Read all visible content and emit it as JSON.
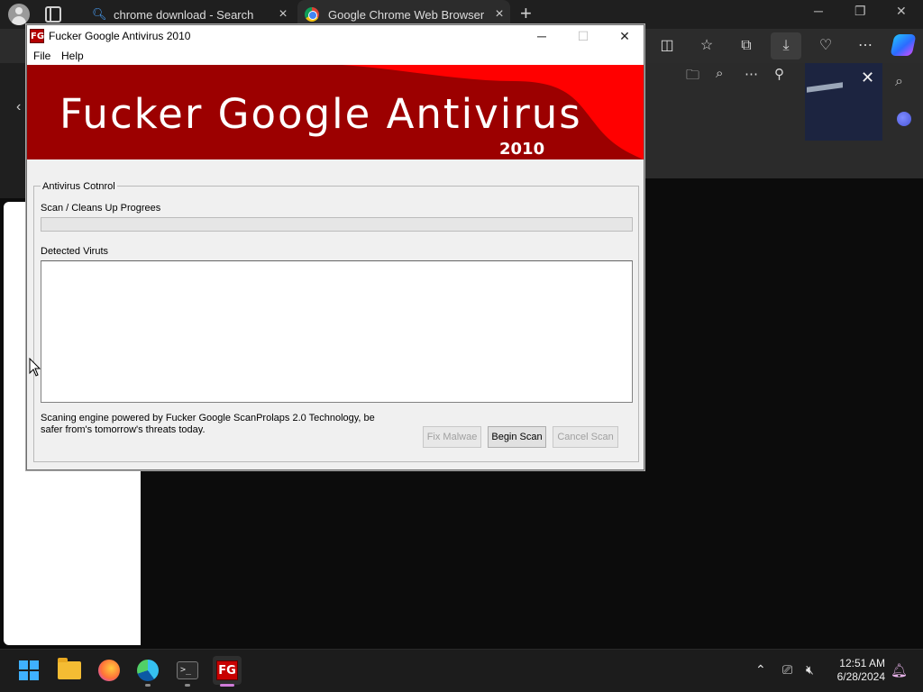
{
  "browser": {
    "tabs": [
      {
        "title": "chrome download - Search",
        "icon": "search-icon"
      },
      {
        "title": "Google Chrome Web Browser",
        "icon": "chrome-icon",
        "active": true
      }
    ],
    "new_tab_label": "+",
    "window_controls": {
      "minimize": "─",
      "restore": "❐",
      "close": "✕"
    },
    "toolbar_icons": [
      "split-screen-icon",
      "favorites-icon",
      "collections-icon",
      "downloads-icon",
      "browser-essentials-icon",
      "more-icon",
      "copilot-icon"
    ],
    "downloads_panel_icons": [
      "open-folder-icon",
      "search-icon",
      "more-icon",
      "pin-icon",
      "close-icon"
    ]
  },
  "app": {
    "title": "Fucker Google Antivirus 2010",
    "icon_text": "FG",
    "menu": [
      "File",
      "Help"
    ],
    "window_controls": {
      "minimize": "─",
      "maximize": "☐",
      "close": "✕"
    },
    "banner": {
      "title": "Fucker Google Antivirus",
      "year": "2010"
    },
    "group_label": "Antivirus Cotnrol",
    "progress_label": "Scan / Cleans Up Progrees",
    "progress_value": 0,
    "detected_label": "Detected Viruts",
    "detected_items": [],
    "footer_text": "Scaning engine powered by Fucker Google ScanProlaps 2.0 Technology, be safer from's tomorrow's threats today.",
    "buttons": {
      "fix": "Fix Malwae",
      "begin": "Begin Scan",
      "cancel": "Cancel Scan"
    }
  },
  "taskbar": {
    "apps": [
      "start-icon",
      "file-explorer-icon",
      "firefox-icon",
      "edge-icon",
      "terminal-icon",
      "fg-antivirus-icon"
    ],
    "terminal_text": ">_",
    "fg_text": "FG",
    "clock": {
      "time": "12:51 AM",
      "date": "6/28/2024"
    }
  }
}
